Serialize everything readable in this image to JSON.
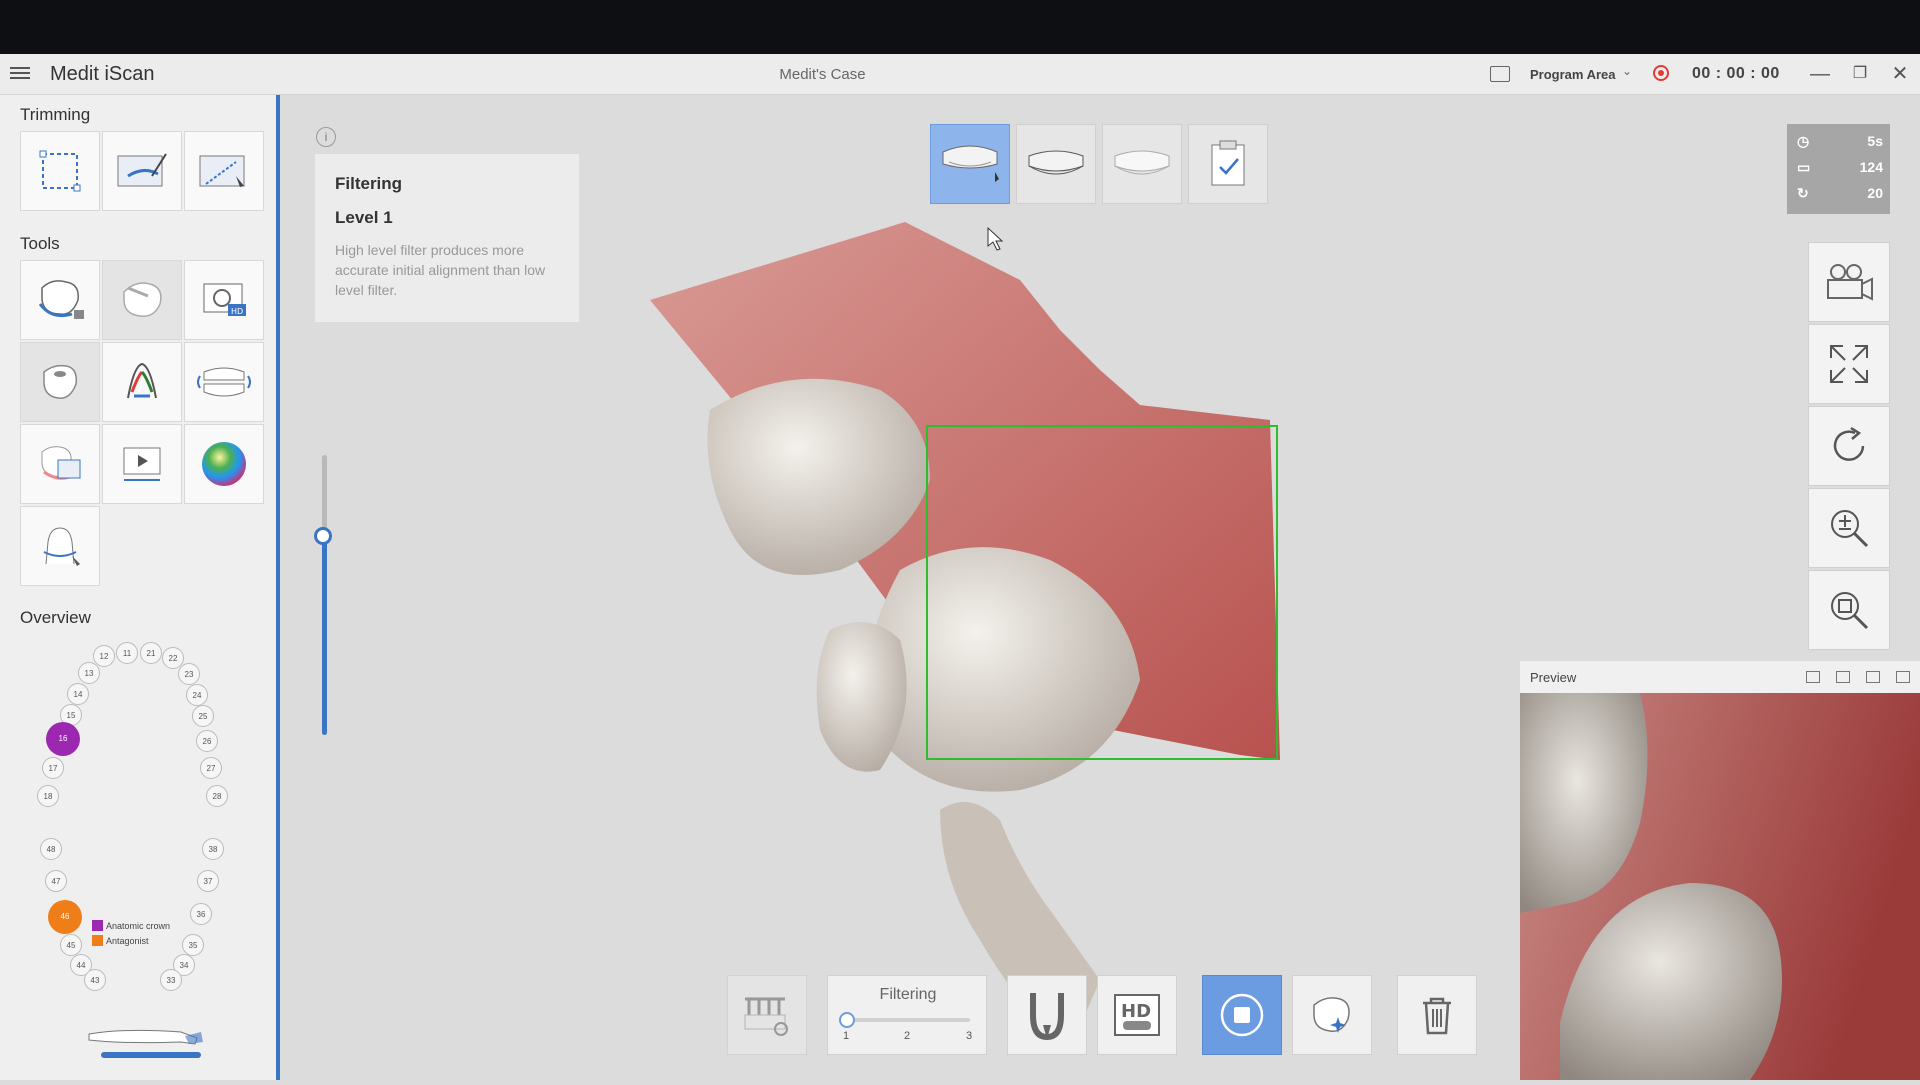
{
  "app": {
    "title": "Medit iScan",
    "case_title": "Medit's Case"
  },
  "titlebar": {
    "program_area": "Program Area",
    "timer": "00 : 00 : 00"
  },
  "sidebar": {
    "trimming_title": "Trimming",
    "tools_title": "Tools",
    "overview_title": "Overview",
    "legend": [
      {
        "label": "Anatomic crown",
        "color": "#9c27b0"
      },
      {
        "label": "Antagonist",
        "color": "#ef7d18"
      }
    ],
    "teeth_upper": [
      "12",
      "11",
      "21",
      "22",
      "13",
      "23",
      "14",
      "24",
      "15",
      "25",
      "16",
      "26",
      "17",
      "27",
      "18",
      "28"
    ],
    "teeth_lower": [
      "48",
      "38",
      "47",
      "37",
      "46",
      "36",
      "45",
      "35",
      "44",
      "34",
      "43",
      "33"
    ]
  },
  "tooltip": {
    "title": "Filtering",
    "level": "Level 1",
    "description": "High level filter produces more accurate initial alignment than low level filter."
  },
  "stats": {
    "time": "5s",
    "frames": "124",
    "rotation": "20"
  },
  "preview": {
    "title": "Preview"
  },
  "bottom": {
    "filter_title": "Filtering",
    "filter_ticks": [
      "1",
      "2",
      "3"
    ],
    "filter_level": 1
  },
  "colors": {
    "accent": "#3a75c4",
    "active_button": "#8eb4ec",
    "crown": "#9c27b0",
    "antagonist": "#ef7d18",
    "scan_box": "#2dbd2d"
  }
}
